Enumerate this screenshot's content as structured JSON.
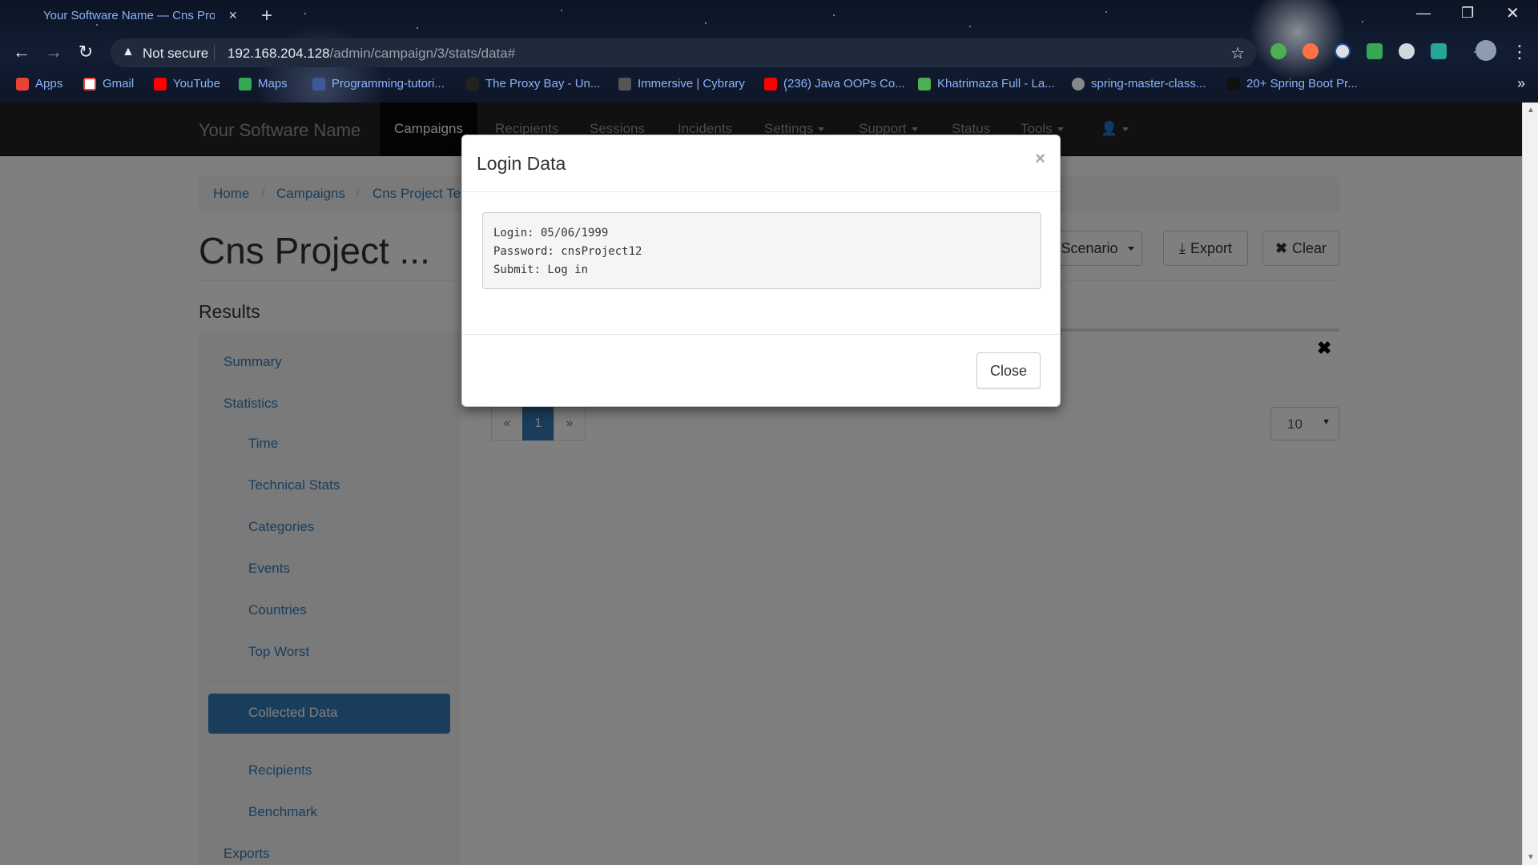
{
  "browser": {
    "tab_title": "Your Software Name — Cns Proje",
    "tab_close": "×",
    "new_tab": "+",
    "security_label": "Not secure",
    "url_host": "192.168.204.128",
    "url_path": "/admin/campaign/3/stats/data#",
    "bookmarks": [
      {
        "label": "Apps",
        "icon": "apps-grid-icon",
        "color": "#ea4335"
      },
      {
        "label": "Gmail",
        "icon": "gmail-icon",
        "color": "#ea4335"
      },
      {
        "label": "YouTube",
        "icon": "youtube-icon",
        "color": "#ff0000"
      },
      {
        "label": "Maps",
        "icon": "maps-icon",
        "color": "#34a853"
      },
      {
        "label": "Programming-tutori...",
        "icon": "bookmark-icon",
        "color": "#3c5a9a"
      },
      {
        "label": "The Proxy Bay - Un...",
        "icon": "bookmark-icon",
        "color": "#222222"
      },
      {
        "label": "Immersive | Cybrary",
        "icon": "cybrary-icon",
        "color": "#555555"
      },
      {
        "label": "(236) Java OOPs Co...",
        "icon": "youtube-icon",
        "color": "#ff0000"
      },
      {
        "label": "Khatrimaza Full - La...",
        "icon": "bookmark-icon",
        "color": "#4caf50"
      },
      {
        "label": "spring-master-class...",
        "icon": "github-icon",
        "color": "#888888"
      },
      {
        "label": "20+ Spring Boot Pr...",
        "icon": "bookmark-icon",
        "color": "#111111"
      }
    ]
  },
  "app": {
    "brand": "Your Software Name",
    "nav": [
      {
        "label": "Campaigns",
        "active": true
      },
      {
        "label": "Recipients"
      },
      {
        "label": "Sessions"
      },
      {
        "label": "Incidents"
      },
      {
        "label": "Settings"
      },
      {
        "label": "Support"
      },
      {
        "label": "Status"
      },
      {
        "label": "Tools"
      }
    ],
    "breadcrumb": [
      "Home",
      "Campaigns",
      "Cns Project Te"
    ],
    "page_title": "Cns Project ...",
    "buttons": {
      "scenario": "Scenario",
      "export": "Export",
      "clear": "Clear"
    },
    "results_title": "Results",
    "sidebar": {
      "summary": "Summary",
      "statistics": "Statistics",
      "stats_items": [
        "Time",
        "Technical Stats",
        "Categories",
        "Events",
        "Countries",
        "Top Worst"
      ],
      "collected_data": "Collected Data",
      "recipients": "Recipients",
      "benchmark": "Benchmark",
      "exports": "Exports"
    },
    "pagination": {
      "prev": "«",
      "current": "1",
      "next": "»"
    },
    "page_size": "10"
  },
  "modal": {
    "title": "Login Data",
    "close_x": "×",
    "lines": [
      "Login: 05/06/1999",
      "Password: cnsProject12",
      "Submit: Log in"
    ],
    "close_button": "Close"
  },
  "colors": {
    "primary": "#337ab7",
    "navbar": "#222222",
    "link_blue": "#8ab4f8"
  }
}
